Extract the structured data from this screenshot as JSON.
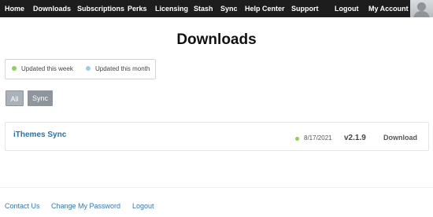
{
  "nav": {
    "items": [
      {
        "label": "Home"
      },
      {
        "label": "Downloads"
      },
      {
        "label": "Subscriptions"
      },
      {
        "label": "Perks"
      },
      {
        "label": "Licensing"
      },
      {
        "label": "Stash"
      },
      {
        "label": "Sync"
      },
      {
        "label": "Help Center"
      },
      {
        "label": "Support"
      },
      {
        "label": "Logout"
      },
      {
        "label": "My Account"
      }
    ]
  },
  "page": {
    "title": "Downloads"
  },
  "legend": {
    "week": {
      "label": "Updated this week",
      "color": "#8fd14f"
    },
    "month": {
      "label": "Updated this month",
      "color": "#9ecbe8"
    }
  },
  "filters": {
    "all_label": "All",
    "sync_label": "Sync"
  },
  "downloads": [
    {
      "name": "iThemes Sync",
      "status_color": "#8fd14f",
      "date": "8/17/2021",
      "version": "v2.1.9",
      "action_label": "Download"
    }
  ],
  "footer": {
    "contact_label": "Contact Us",
    "change_password_label": "Change My Password",
    "logout_label": "Logout"
  },
  "colors": {
    "nav_bg": "#1d1d1d",
    "link": "#2d79b7"
  }
}
